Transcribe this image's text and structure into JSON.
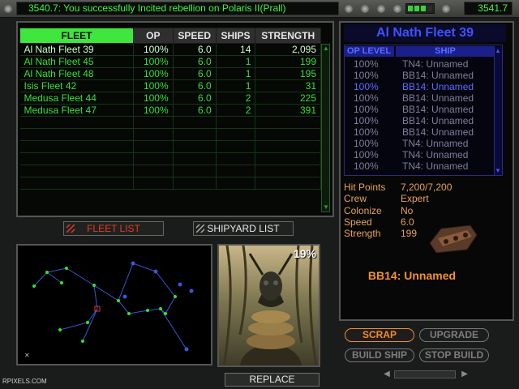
{
  "topbar": {
    "message": "3540.7: You successfully Incited rebellion on Polaris II(Prall)",
    "credits": "3541.7"
  },
  "fleet_table": {
    "headers": [
      "FLEET",
      "OP",
      "SPEED",
      "SHIPS",
      "STRENGTH"
    ],
    "rows": [
      {
        "name": "Al Nath Fleet 39",
        "op": "100%",
        "speed": "6.0",
        "ships": "14",
        "strength": "2,095"
      },
      {
        "name": "Al Nath Fleet 45",
        "op": "100%",
        "speed": "6.0",
        "ships": "1",
        "strength": "199"
      },
      {
        "name": "Al Nath Fleet 48",
        "op": "100%",
        "speed": "6.0",
        "ships": "1",
        "strength": "195"
      },
      {
        "name": "Isis Fleet 42",
        "op": "100%",
        "speed": "6.0",
        "ships": "1",
        "strength": "31"
      },
      {
        "name": "Medusa Fleet 44",
        "op": "100%",
        "speed": "6.0",
        "ships": "2",
        "strength": "225"
      },
      {
        "name": "Medusa Fleet 47",
        "op": "100%",
        "speed": "6.0",
        "ships": "2",
        "strength": "391"
      }
    ]
  },
  "tabs": {
    "fleet_list": "FLEET LIST",
    "shipyard_list": "SHIPYARD LIST"
  },
  "portrait": {
    "percent": "19%",
    "replace_label": "REPLACE"
  },
  "detail": {
    "title": "Al Nath Fleet 39",
    "list_headers": [
      "OP LEVEL",
      "SHIP"
    ],
    "ships": [
      {
        "op": "100%",
        "ship": "TN4: Unnamed"
      },
      {
        "op": "100%",
        "ship": "BB14: Unnamed"
      },
      {
        "op": "100%",
        "ship": "BB14: Unnamed"
      },
      {
        "op": "100%",
        "ship": "BB14: Unnamed"
      },
      {
        "op": "100%",
        "ship": "BB14: Unnamed"
      },
      {
        "op": "100%",
        "ship": "BB14: Unnamed"
      },
      {
        "op": "100%",
        "ship": "BB14: Unnamed"
      },
      {
        "op": "100%",
        "ship": "TN4: Unnamed"
      },
      {
        "op": "100%",
        "ship": "TN4: Unnamed"
      },
      {
        "op": "100%",
        "ship": "TN4: Unnamed"
      }
    ],
    "stats": {
      "hit_points_label": "Hit Points",
      "hit_points": "7,200/7,200",
      "crew_label": "Crew",
      "crew": "Expert",
      "colonize_label": "Colonize",
      "colonize": "No",
      "speed_label": "Speed",
      "speed": "6.0",
      "strength_label": "Strength",
      "strength": "199"
    },
    "selected_ship": "BB14: Unnamed"
  },
  "actions": {
    "scrap": "SCRAP",
    "upgrade": "UPGRADE",
    "build_ship": "BUILD SHIP",
    "stop_build": "STOP BUILD"
  },
  "watermark": "RPIXELS.COM",
  "colors": {
    "fleet_text": "#36e036",
    "accent_green": "#3ee63e",
    "detail_blue": "#3f52ff",
    "stat_orange": "#e6a35a",
    "scrap_orange": "#f28c2e"
  }
}
